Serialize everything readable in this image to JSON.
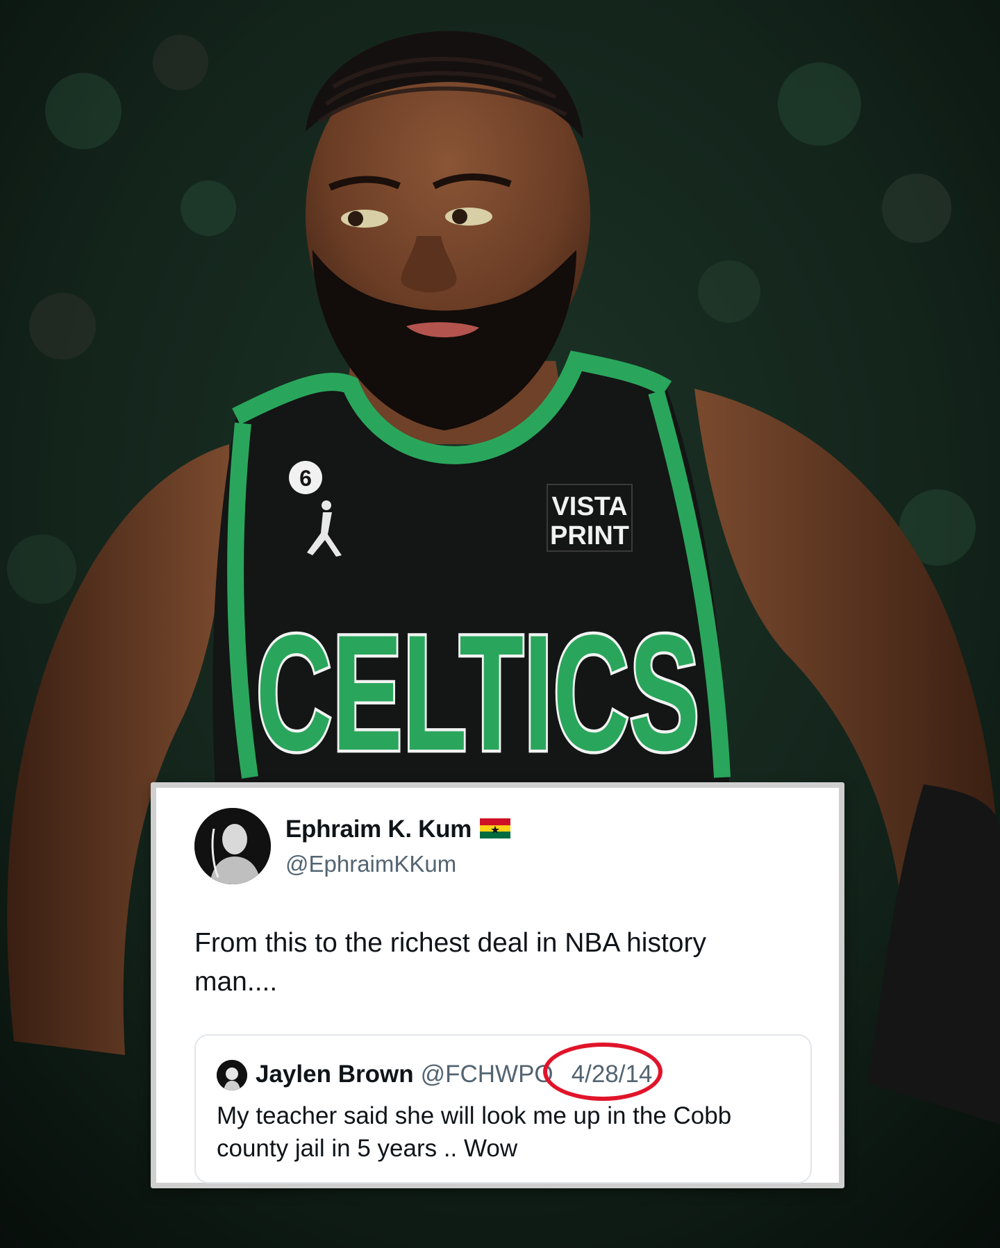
{
  "colors": {
    "jersey": "#141515",
    "jersey_green": "#2aa65c",
    "text_primary": "#0f1419",
    "text_secondary": "#536471",
    "highlight_circle": "#e0142a"
  },
  "photo": {
    "jersey_number": "6",
    "sponsor_line1": "VISTA",
    "sponsor_line2": "PRINT",
    "team_wordmark": "CELTICS"
  },
  "tweet": {
    "author_name": "Ephraim K. Kum",
    "author_handle": "@EphraimKKum",
    "flag_icon": "ghana-flag-icon",
    "text": "From this to the richest deal in NBA history man....",
    "quote": {
      "name": "Jaylen Brown",
      "handle": "@FCHWPO",
      "date": "4/28/14",
      "text": "My teacher said she will look me up in the Cobb county jail in 5 years .. Wow"
    }
  }
}
